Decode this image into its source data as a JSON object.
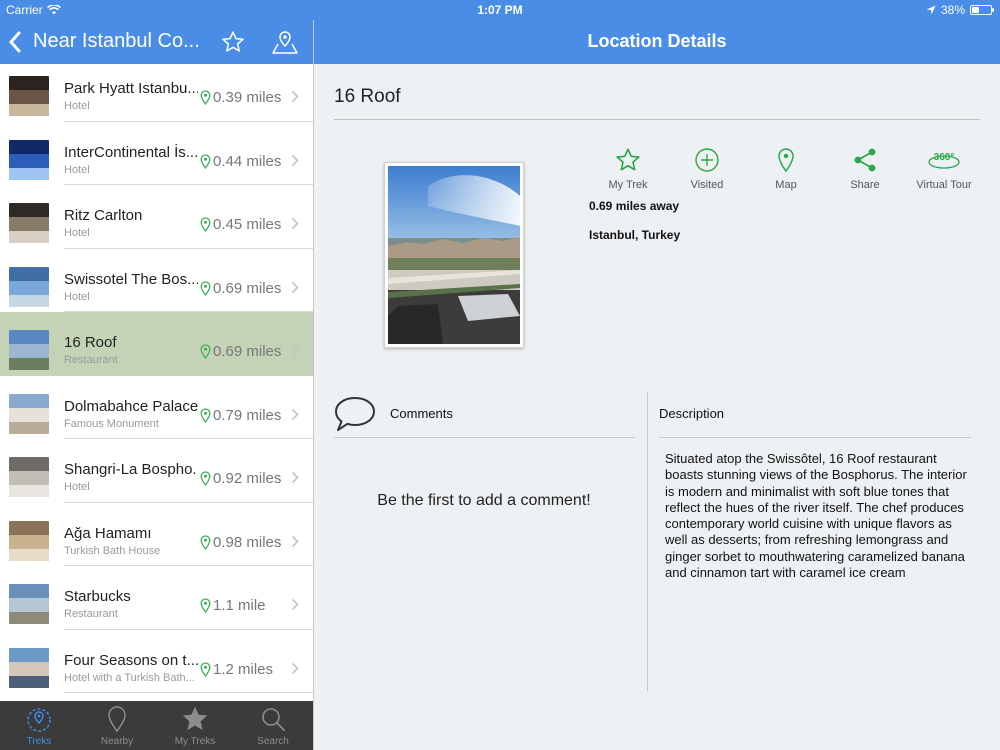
{
  "status_bar": {
    "carrier": "Carrier",
    "time": "1:07 PM",
    "battery": "38%",
    "battery_level": 0.38
  },
  "left_nav": {
    "title": "Near Istanbul Co..."
  },
  "right_nav": {
    "title": "Location Details"
  },
  "list": [
    {
      "name": "Park Hyatt Istanbu...",
      "type": "Hotel",
      "distance": "0.39 miles"
    },
    {
      "name": "InterContinental İs...",
      "type": "Hotel",
      "distance": "0.44 miles"
    },
    {
      "name": "Ritz Carlton",
      "type": "Hotel",
      "distance": "0.45 miles"
    },
    {
      "name": "Swissotel The Bos...",
      "type": "Hotel",
      "distance": "0.69 miles"
    },
    {
      "name": "16 Roof",
      "type": "Restaurant",
      "distance": "0.69 miles",
      "selected": true
    },
    {
      "name": "Dolmabahce Palace",
      "type": "Famous Monument",
      "distance": "0.79 miles"
    },
    {
      "name": "Shangri-La Bospho...",
      "type": "Hotel",
      "distance": "0.92 miles"
    },
    {
      "name": "Ağa Hamamı",
      "type": "Turkish Bath House",
      "distance": "0.98 miles"
    },
    {
      "name": "Starbucks",
      "type": "Restaurant",
      "distance": "1.1 mile"
    },
    {
      "name": "Four Seasons on t...",
      "type": "Hotel with a Turkish Bath...",
      "distance": "1.2 miles"
    }
  ],
  "tabs": [
    {
      "label": "Treks",
      "icon": "compass-pin-icon",
      "active": true
    },
    {
      "label": "Nearby",
      "icon": "map-pin-outline-icon"
    },
    {
      "label": "My Treks",
      "icon": "star-icon"
    },
    {
      "label": "Search",
      "icon": "search-icon"
    }
  ],
  "detail": {
    "title": "16 Roof",
    "actions": [
      {
        "label": "My Trek",
        "icon": "star-outline-icon"
      },
      {
        "label": "Visited",
        "icon": "plus-circle-icon"
      },
      {
        "label": "Map",
        "icon": "map-pin-icon"
      },
      {
        "label": "Share",
        "icon": "share-icon"
      },
      {
        "label": "Virtual Tour",
        "icon": "360-view-icon"
      }
    ],
    "distance_away": "0.69 miles away",
    "location": "Istanbul, Turkey",
    "comments_label": "Comments",
    "empty_comments": "Be the first to add a comment!",
    "description_label": "Description",
    "description": "Situated atop the Swissôtel, 16 Roof restaurant boasts stunning views of the Bosphorus. The interior is modern and minimalist with soft blue tones that reflect the hues of the river itself. The chef produces contemporary world cuisine with unique flavors as well as desserts; from refreshing lemongrass and ginger sorbet to mouthwatering caramelized banana and cinnamon tart with caramel ice cream"
  },
  "colors": {
    "nav_blue": "#4a8de6",
    "accent_green": "#2aa84a",
    "selected_row": "#c4d3b6",
    "tab_active": "#3d8fe8"
  }
}
